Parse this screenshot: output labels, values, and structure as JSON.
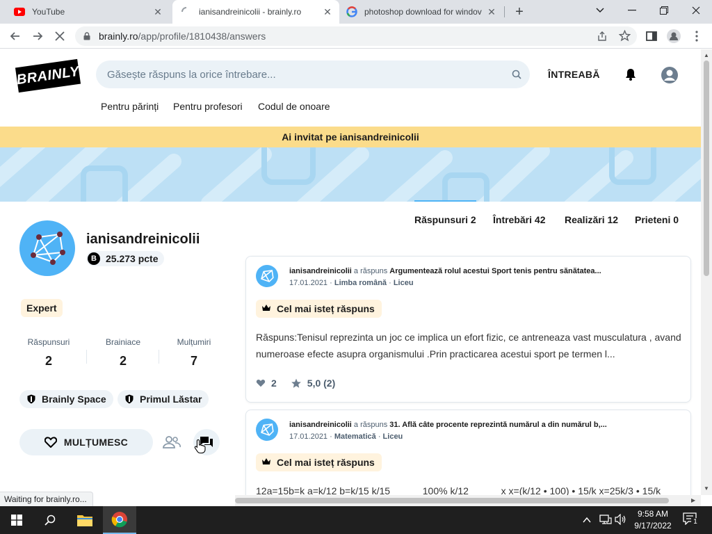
{
  "browser": {
    "tabs": [
      {
        "title": "YouTube",
        "favicon": "youtube-icon",
        "active": false
      },
      {
        "title": "ianisandreinicolii - brainly.ro",
        "favicon": "loading-spinner-icon",
        "active": true
      },
      {
        "title": "photoshop download for windov",
        "favicon": "google-icon",
        "active": false
      }
    ],
    "url_host": "brainly.ro",
    "url_path": "/app/profile/1810438/answers",
    "status_text": "Waiting for brainly.ro..."
  },
  "site": {
    "logo_text": "BRAINLY",
    "search_placeholder": "Găsește răspuns la orice întrebare...",
    "ask_label": "ÎNTREABĂ",
    "subnav": [
      "Pentru părinți",
      "Pentru profesori",
      "Codul de onoare"
    ],
    "banner": "Ai invitat pe ianisandreinicolii"
  },
  "profile": {
    "username": "ianisandreinicolii",
    "points": "25.273 pcte",
    "rank": "Expert",
    "stats": [
      {
        "label": "Răspunsuri",
        "value": "2"
      },
      {
        "label": "Brainiace",
        "value": "2"
      },
      {
        "label": "Mulțumiri",
        "value": "7"
      }
    ],
    "badges": [
      "Brainly Space",
      "Primul Lăstar"
    ],
    "thank_label": "MULȚUMESC"
  },
  "tabs": [
    {
      "label": "Răspunsuri 2",
      "active": true
    },
    {
      "label": "Întrebări 42",
      "active": false
    },
    {
      "label": "Realizări 12",
      "active": false
    },
    {
      "label": "Prieteni 0",
      "active": false
    }
  ],
  "answers": [
    {
      "author": "ianisandreinicolii",
      "action": "a răspuns",
      "question": "Argumentează rolul acestui Sport tenis pentru sănătatea...",
      "date": "17.01.2021",
      "subject": "Limba română",
      "level": "Liceu",
      "best_label": "Cel mai isteț răspuns",
      "body": "Răspuns:Tenisul reprezinta un joc ce implica un efort fizic, ce antreneaza vast musculatura , avand numeroase efecte asupra organismului .Prin practicarea acestui sport pe termen l...",
      "likes": "2",
      "rating": "5,0 (2)"
    },
    {
      "author": "ianisandreinicolii",
      "action": "a răspuns",
      "question": "31. Află câte procente reprezintă numărul a din numărul b,...",
      "date": "17.01.2021",
      "subject": "Matematică",
      "level": "Liceu",
      "best_label": "Cel mai isteț răspuns",
      "body": "12a=15b=k a=k/12 b=k/15 k/15 _____ 100% k/12 _____ x x=(k/12 • 100) • 15/k x=25k/3 • 15/k"
    }
  ],
  "taskbar": {
    "time": "9:58 AM",
    "date": "9/17/2022",
    "notifications": "1"
  },
  "colors": {
    "brand_blue": "#4fb3f6",
    "banner_yellow": "#fbdc8b",
    "cover_blue": "#bde0f5"
  }
}
